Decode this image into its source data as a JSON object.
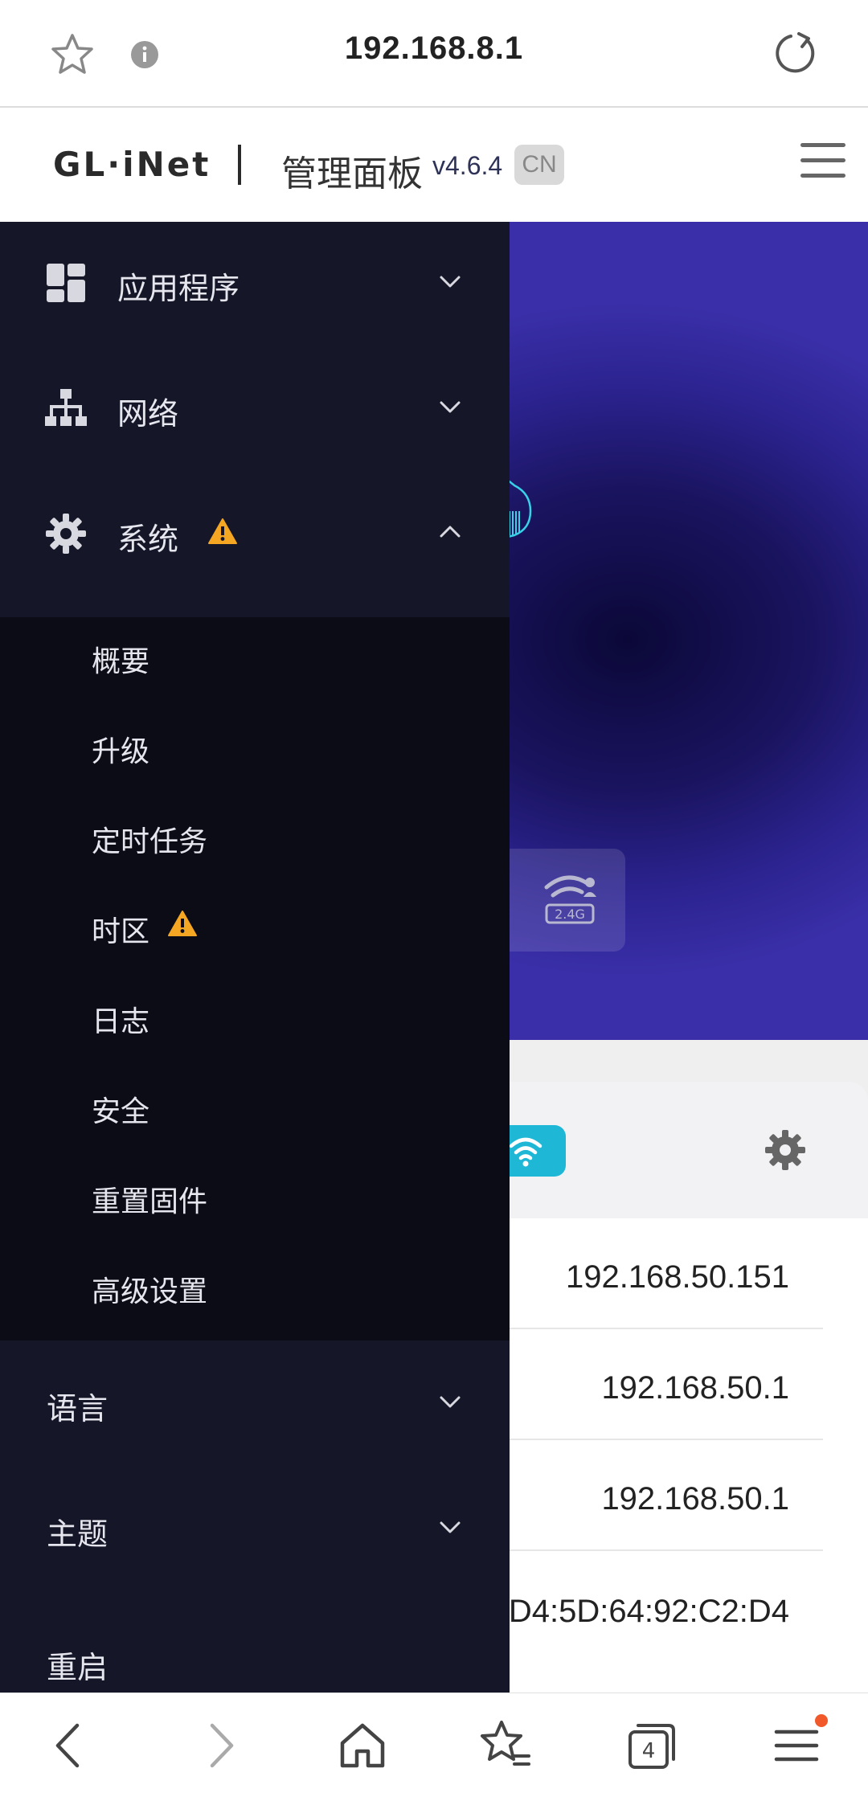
{
  "browser": {
    "url": "192.168.8.1"
  },
  "header": {
    "logo": "GL·iNet",
    "title": "管理面板",
    "version": "v4.6.4",
    "region": "CN"
  },
  "hero": {
    "band_label": "2.4G"
  },
  "menu": {
    "items": [
      {
        "label": "应用程序",
        "icon": "grid-icon",
        "expanded": false
      },
      {
        "label": "网络",
        "icon": "network-icon",
        "expanded": false
      },
      {
        "label": "系统",
        "icon": "gear-icon",
        "expanded": true,
        "warning": true
      }
    ],
    "system_sub": [
      {
        "label": "概要"
      },
      {
        "label": "升级"
      },
      {
        "label": "定时任务"
      },
      {
        "label": "时区",
        "warning": true
      },
      {
        "label": "日志"
      },
      {
        "label": "安全"
      },
      {
        "label": "重置固件"
      },
      {
        "label": "高级设置"
      }
    ],
    "language": "语言",
    "theme": "主题",
    "reboot": "重启"
  },
  "info_rows": [
    {
      "value": "192.168.50.151"
    },
    {
      "value": "192.168.50.1"
    },
    {
      "value": "192.168.50.1"
    },
    {
      "value": "D4:5D:64:92:C2:D4"
    }
  ],
  "bottom_nav": {
    "tab_count": "4"
  },
  "colors": {
    "menu_bg": "#151628",
    "submenu_bg": "#0c0c16",
    "accent": "#1eb7d6",
    "warning": "#f5a623",
    "hero": "#2c2390"
  }
}
